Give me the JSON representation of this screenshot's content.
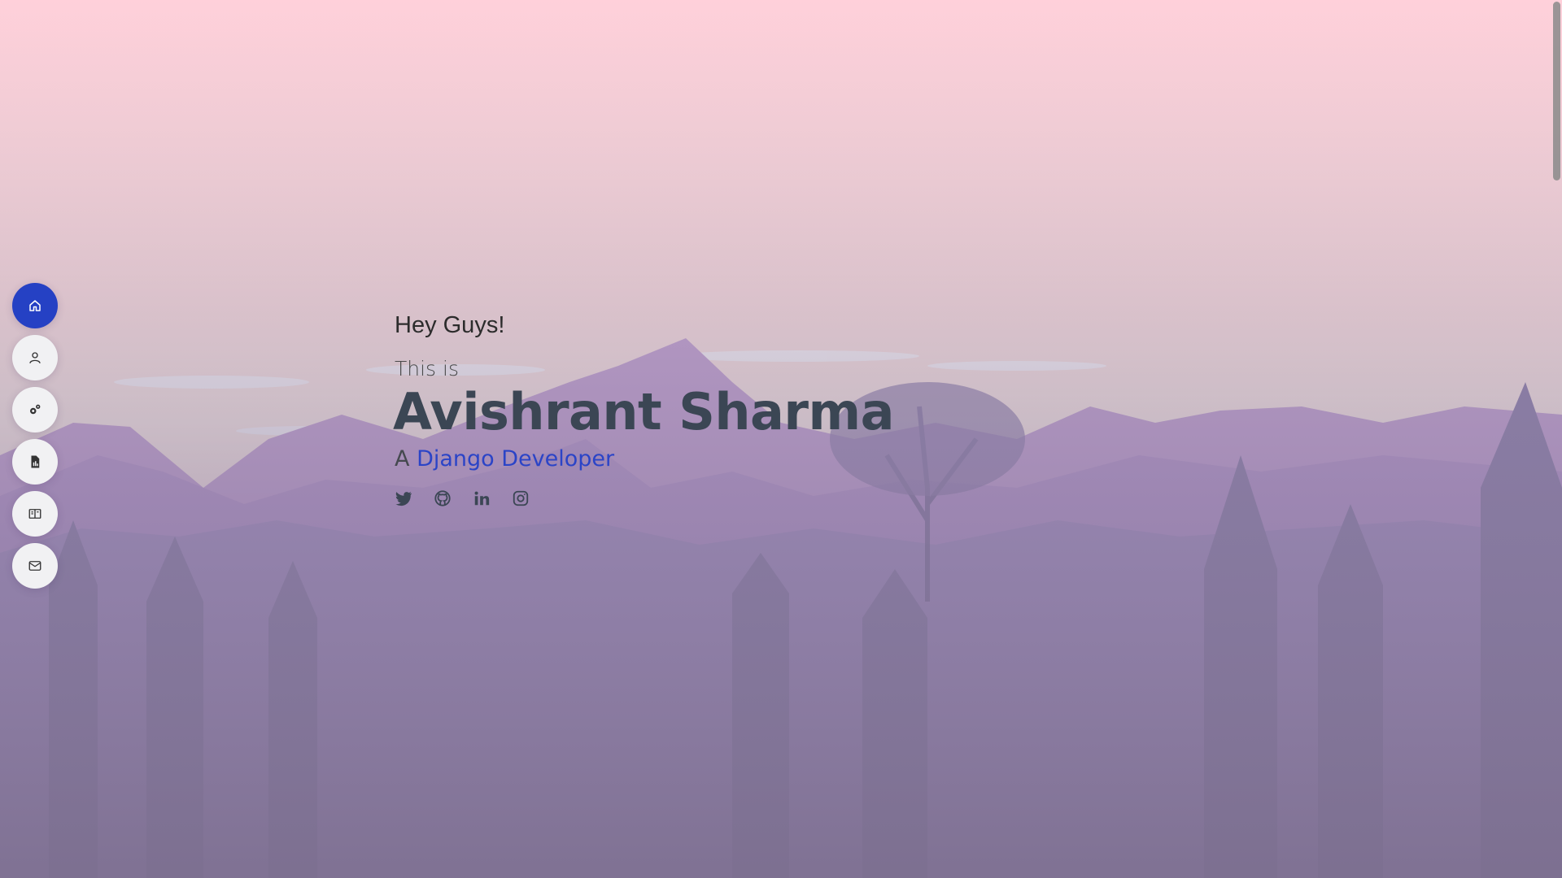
{
  "colors": {
    "accent": "#2541c4",
    "name_text": "#3b4654",
    "nav_bg": "#f1f1f3"
  },
  "side_nav": [
    {
      "icon": "home-icon",
      "active": true
    },
    {
      "icon": "user-icon",
      "active": false
    },
    {
      "icon": "gears-icon",
      "active": false
    },
    {
      "icon": "resume-file-icon",
      "active": false
    },
    {
      "icon": "book-icon",
      "active": false
    },
    {
      "icon": "envelope-icon",
      "active": false
    }
  ],
  "hero": {
    "greeting": "Hey Guys!",
    "intro": "This is",
    "name": "Avishrant Sharma",
    "role_prefix": "A",
    "role": "Django Developer"
  },
  "socials": [
    "twitter-icon",
    "github-icon",
    "linkedin-icon",
    "instagram-icon"
  ]
}
